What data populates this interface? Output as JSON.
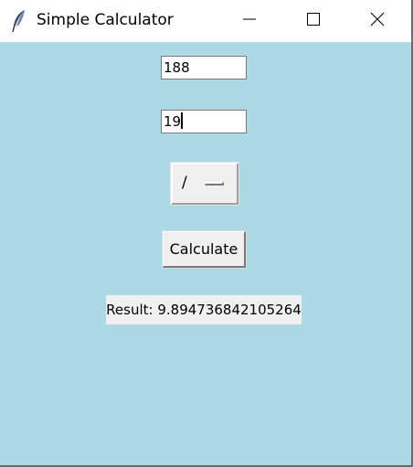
{
  "window": {
    "title": "Simple Calculator",
    "app_icon": "feather-icon",
    "controls": {
      "minimize_icon": "minimize-icon",
      "maximize_icon": "maximize-icon",
      "close_icon": "close-icon"
    }
  },
  "form": {
    "first_number": "188",
    "second_number": "19",
    "operator": "/",
    "calculate_label": "Calculate",
    "result_text": "Result: 9.894736842105264"
  },
  "colors": {
    "client_background": "#add8e6",
    "widget_background": "#f0f0f0"
  }
}
